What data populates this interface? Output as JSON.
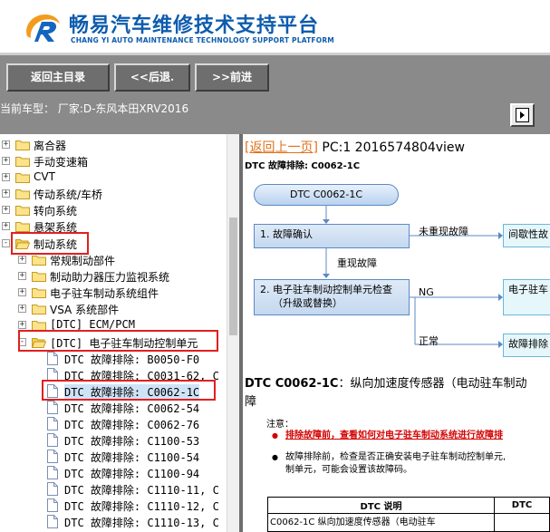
{
  "brand": {
    "title": "畅易汽车维修技术支持平台",
    "subtitle": "CHANG YI AUTO MAINTENANCE TECHNOLOGY SUPPORT PLATFORM"
  },
  "toolbar": {
    "back_home": "返回主目录",
    "back": "<<后退.",
    "forward": ">>前进"
  },
  "vehicle": {
    "text": "当前车型： 厂家:D-东风本田XRV2016"
  },
  "tree": {
    "folders": [
      {
        "label": "离合器"
      },
      {
        "label": "手动变速箱"
      },
      {
        "label": "CVT"
      },
      {
        "label": "传动系统/车桥"
      },
      {
        "label": "转向系统"
      },
      {
        "label": "悬架系统"
      },
      {
        "label": "制动系统"
      }
    ],
    "subfolders": [
      {
        "label": "常规制动部件"
      },
      {
        "label": "制动助力器压力监视系统"
      },
      {
        "label": "电子驻车制动系统组件"
      },
      {
        "label": "VSA 系统部件"
      },
      {
        "label": "[DTC] ECM/PCM"
      },
      {
        "label": "[DTC] 电子驻车制动控制单元"
      }
    ],
    "docs": [
      {
        "label": "DTC 故障排除: B0050-F0"
      },
      {
        "label": "DTC 故障排除: C0031-62, C"
      },
      {
        "label": "DTC 故障排除: C0062-1C"
      },
      {
        "label": "DTC 故障排除: C0062-54"
      },
      {
        "label": "DTC 故障排除: C0062-76"
      },
      {
        "label": "DTC 故障排除: C1100-53"
      },
      {
        "label": "DTC 故障排除: C1100-54"
      },
      {
        "label": "DTC 故障排除: C1100-94"
      },
      {
        "label": "DTC 故障排除: C1110-11, C"
      },
      {
        "label": "DTC 故障排除: C1110-12, C"
      },
      {
        "label": "DTC 故障排除: C1110-13, C"
      }
    ]
  },
  "content": {
    "back_link": "[返回上一页]",
    "page_code": "PC:1 2016574804view",
    "subtitle": "DTC 故障排除: C0062-1C",
    "flow": {
      "start": "DTC C0062-1C",
      "step1": "1.  故障确认",
      "no_repro": "未重现故障",
      "intermittent": "间歇性故",
      "repro": "重现故障",
      "step2_line1": "2.  电子驻车制动控制单元检查",
      "step2_line2": "（升级或替换）",
      "ng": "NG",
      "ng_target": "电子驻车",
      "normal": "正常",
      "normal_target": "故障排除"
    },
    "dtc_code": "DTC C0062-1C",
    "dtc_desc": "：纵向加速度传感器（电动驻车制动",
    "dtc_desc2": "障",
    "note_label": "注意：",
    "note1": "排除故障前，查看如何对电子驻车制动系统进行故障排",
    "note2": "故障排除前，检查是否正确安装电子驻车制动控制单元,",
    "note2b": "制单元，可能会设置该故障码。",
    "table": {
      "col1": "DTC 说明",
      "col2": "DTC",
      "row1": "C0062-1C 纵向加速度传感器（电动驻车"
    }
  }
}
